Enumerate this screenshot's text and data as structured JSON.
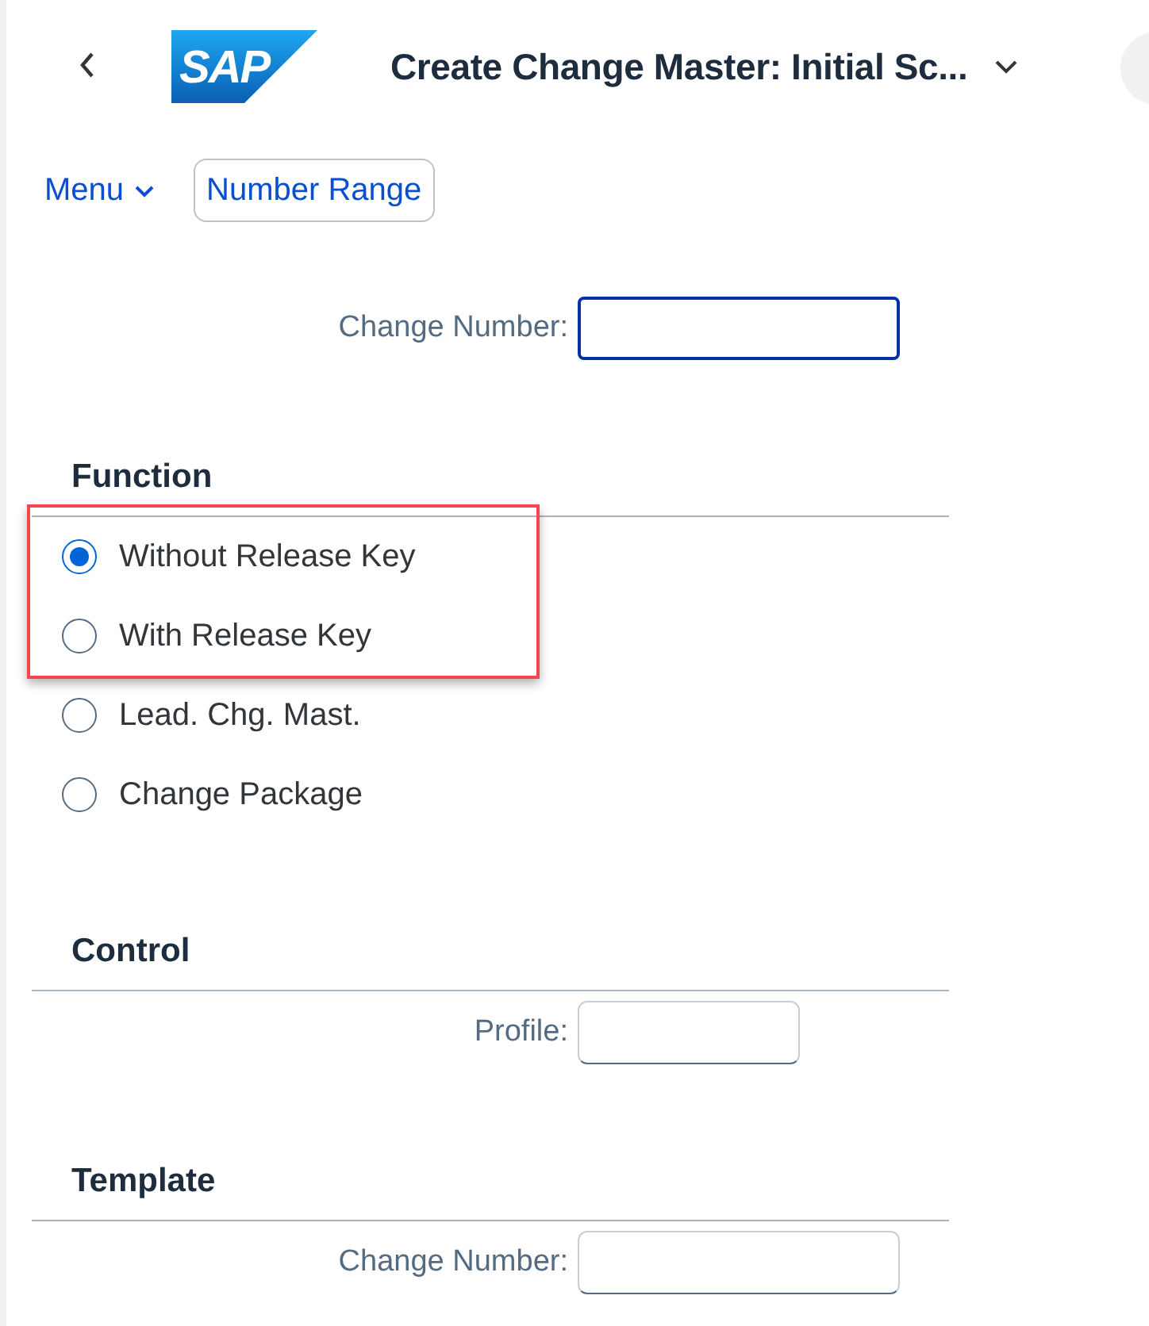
{
  "header": {
    "logo_text": "SAP",
    "title": "Create Change Master: Initial Sc..."
  },
  "toolbar": [
    {
      "kind": "menu",
      "label": "Menu"
    },
    {
      "kind": "button",
      "label": "Number Range"
    }
  ],
  "top_field": {
    "label": "Change Number:",
    "focused": true,
    "kind": "long"
  },
  "sections": [
    {
      "title": "Function",
      "radio_groups": [
        {
          "highlighted": true,
          "radios": [
            {
              "label": "Without Release Key",
              "selected": true
            },
            {
              "label": "With Release Key",
              "selected": false
            }
          ]
        },
        {
          "highlighted": false,
          "radios": [
            {
              "label": "Lead. Chg. Mast.",
              "selected": false
            },
            {
              "label": "Change Package",
              "selected": false
            }
          ]
        }
      ]
    },
    {
      "title": "Control",
      "fields": [
        {
          "label": "Profile:",
          "focused": false,
          "kind": "short"
        }
      ]
    },
    {
      "title": "Template",
      "fields": [
        {
          "label": "Change Number:",
          "focused": false,
          "kind": "long"
        }
      ]
    }
  ]
}
